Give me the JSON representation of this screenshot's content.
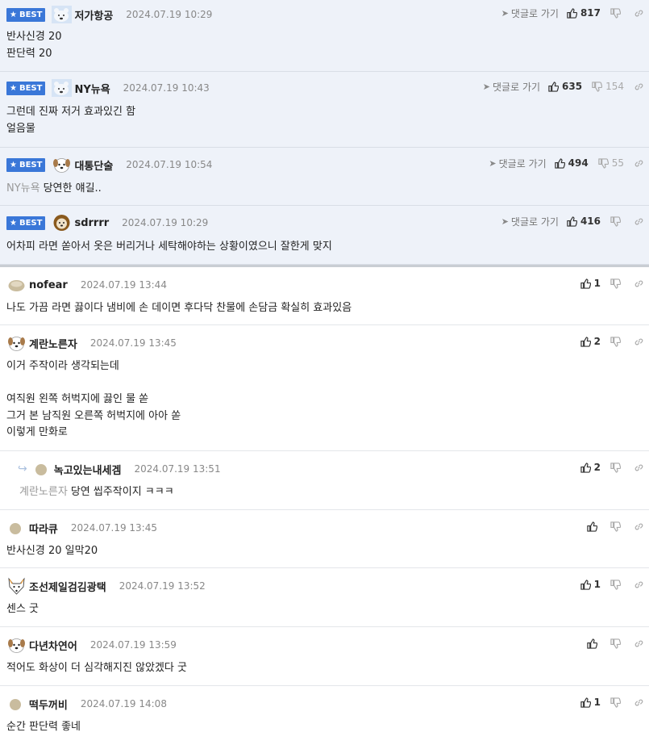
{
  "best_label": "BEST",
  "goto_label": "댓글로 가기",
  "comments": [
    {
      "nick": "저가항공",
      "date": "2024.07.19 10:29",
      "likes": "817",
      "dislikes": "",
      "lines": [
        "반사신경 20",
        "판단력 20"
      ],
      "avatar": "polar-bear-icon"
    },
    {
      "nick": "NY뉴욕",
      "date": "2024.07.19 10:43",
      "likes": "635",
      "dislikes": "154",
      "lines": [
        "그런데 진짜 저거 효과있긴 함",
        "얼음물"
      ],
      "avatar": "polar-bear-icon"
    },
    {
      "nick": "대통단술",
      "date": "2024.07.19 10:54",
      "likes": "494",
      "dislikes": "55",
      "mention": "NY뉴욕",
      "lines": [
        "당연한 얘길.."
      ],
      "avatar": "dog-face-icon"
    },
    {
      "nick": "sdrrrr",
      "date": "2024.07.19 10:29",
      "likes": "416",
      "dislikes": "",
      "lines": [
        "어차피 라면 쏟아서 옷은 버리거나 세탁해야하는 상황이였으니 잘한게 맞지"
      ],
      "avatar": "lion-face-icon"
    },
    {
      "nick": "nofear",
      "date": "2024.07.19 13:44",
      "likes": "1",
      "lines": [
        "나도 가끔 라면 끓이다 냄비에 손 데이면 후다닥 찬물에 손담금 확실히 효과있음"
      ],
      "avatar": "blob-icon"
    },
    {
      "nick": "계란노른자",
      "date": "2024.07.19 13:45",
      "likes": "2",
      "lines": [
        "이거 주작이라 생각되는데",
        "",
        "여직원 왼쪽 허벅지에 끓인 물 쏟",
        "그거 본 남직원 오른쪽 허벅지에 아아 쏟",
        "이렇게 만화로"
      ],
      "avatar": "dog-face-icon"
    },
    {
      "nick": "녹고있는내세겜",
      "date": "2024.07.19 13:51",
      "likes": "2",
      "mention": "계란노른자",
      "lines": [
        "당연 씹주작이지 ㅋㅋㅋ"
      ],
      "avatar": "circle-icon"
    },
    {
      "nick": "따라큐",
      "date": "2024.07.19 13:45",
      "likes": "",
      "lines": [
        "반사신경 20 일막20"
      ],
      "avatar": "circle-icon"
    },
    {
      "nick": "조선제일검김광택",
      "date": "2024.07.19 13:52",
      "likes": "1",
      "lines": [
        "센스 굿"
      ],
      "avatar": "fox-face-icon"
    },
    {
      "nick": "다년차연어",
      "date": "2024.07.19 13:59",
      "likes": "",
      "lines": [
        "적어도 화상이 더 심각해지진 않았겠다 굿"
      ],
      "avatar": "dog-face-icon"
    },
    {
      "nick": "떡두꺼비",
      "date": "2024.07.19 14:08",
      "likes": "1",
      "lines": [
        "순간 판단력 좋네"
      ],
      "avatar": "circle-icon"
    }
  ]
}
